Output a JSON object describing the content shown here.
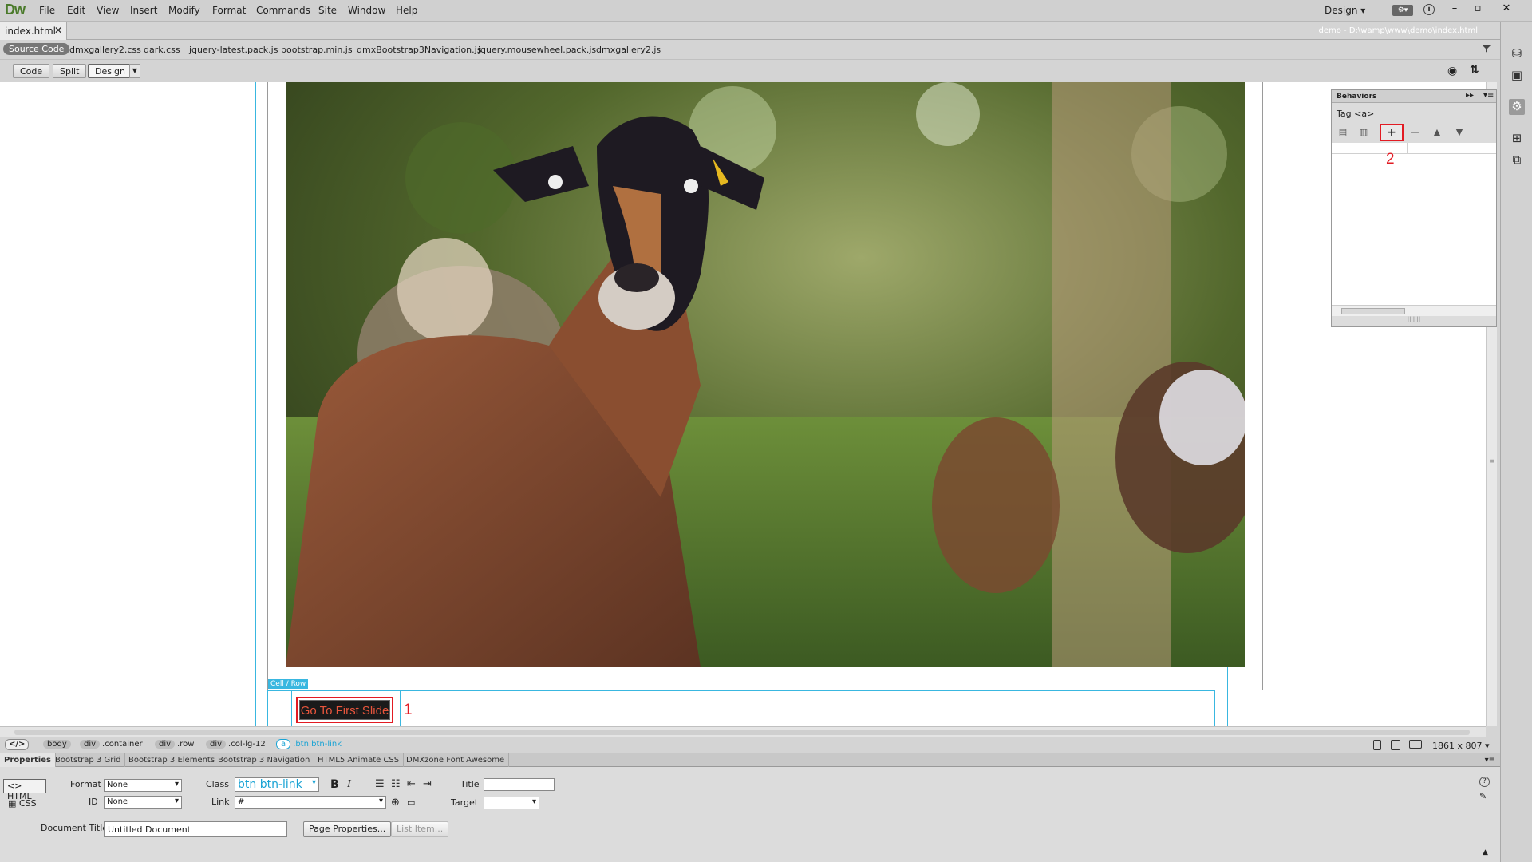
{
  "app": {
    "logo": "Dw",
    "menu": [
      "File",
      "Edit",
      "View",
      "Insert",
      "Modify",
      "Format",
      "Commands",
      "Site",
      "Window",
      "Help"
    ],
    "workspace": "Design",
    "window_controls": [
      "–",
      "▫",
      "✕"
    ]
  },
  "document": {
    "tab_name": "index.html",
    "path": "demo - D:\\wamp\\www\\demo\\index.html",
    "related_files": [
      "Source Code",
      "dmxgallery2.css",
      "dark.css",
      "jquery-latest.pack.js",
      "bootstrap.min.js",
      "dmxBootstrap3Navigation.js",
      "jquery.mousewheel.pack.js",
      "dmxgallery2.js"
    ]
  },
  "view_bar": {
    "code": "Code",
    "split": "Split",
    "design": "Design"
  },
  "canvas": {
    "row_label": "Cell / Row",
    "button_text": "Go To First Slide",
    "annotation_1": "1"
  },
  "behaviors_panel": {
    "title": "Behaviors",
    "tag": "Tag <a>",
    "add_button": "+",
    "annotation_2": "2"
  },
  "tag_selector": {
    "code_icon": "</>",
    "tags": [
      {
        "tag": "body",
        "cls": ""
      },
      {
        "tag": "div",
        "cls": ".container"
      },
      {
        "tag": "div",
        "cls": ".row"
      },
      {
        "tag": "div",
        "cls": ".col-lg-12"
      },
      {
        "tag": "a",
        "cls": ".btn.btn-link"
      }
    ],
    "doc_size": "1861 x 807"
  },
  "properties": {
    "tabs": [
      "Properties",
      "Bootstrap 3 Grid",
      "Bootstrap 3 Elements",
      "Bootstrap 3 Navigation",
      "HTML5 Animate CSS",
      "DMXzone Font Awesome"
    ],
    "html_mode": "HTML",
    "css_mode": "CSS",
    "format_label": "Format",
    "format_value": "None",
    "id_label": "ID",
    "id_value": "None",
    "class_label": "Class",
    "class_value": "btn btn-link",
    "link_label": "Link",
    "link_value": "#",
    "title_label": "Title",
    "title_value": "",
    "target_label": "Target",
    "target_value": "",
    "doc_title_label": "Document Title",
    "doc_title_value": "Untitled Document",
    "page_properties": "Page Properties...",
    "list_item": "List Item..."
  }
}
